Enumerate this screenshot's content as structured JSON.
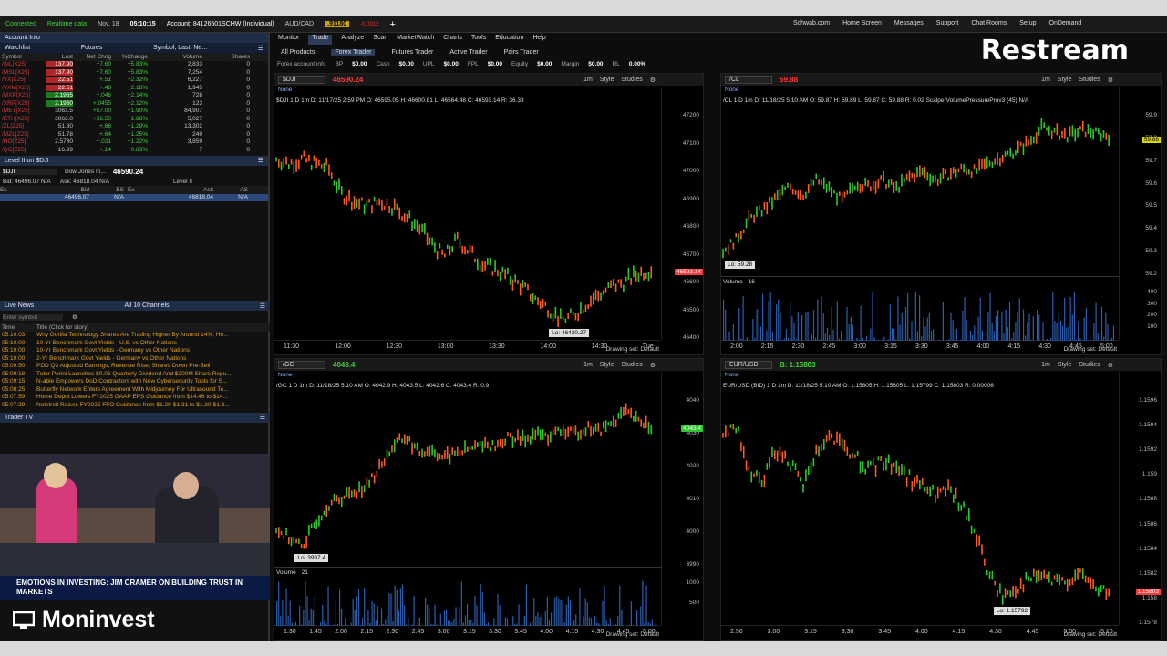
{
  "topbar": {
    "connected": "Connected",
    "realtime": "Realtime data",
    "date": "Nov, 18",
    "time": "05:10:15",
    "account": "Account: 84126501SCHW (Individual)",
    "pair": "AUD/CAD",
    "pair_price": ".91180",
    "pair_chg": "-0.0012"
  },
  "account_info": "Account Info",
  "watchlist": {
    "title": "Watchlist",
    "list": "Futures",
    "filter": "Symbol, Last, Ne...",
    "headers": [
      "Symbol",
      "Last",
      "Net Chng",
      "%Change",
      "Volume",
      "Shares"
    ],
    "rows": [
      [
        "/SIL[X25]",
        "137.90",
        "+7.60",
        "+5.83%",
        "2,833",
        "0"
      ],
      [
        "/MSL[X25]",
        "137.90",
        "+7.60",
        "+5.83%",
        "7,254",
        "0"
      ],
      [
        "/VX[X25]",
        "22.51",
        "+.51",
        "+2.32%",
        "6,227",
        "0"
      ],
      [
        "/VXM[X25]",
        "22.51",
        "+.48",
        "+2.18%",
        "1,945",
        "0"
      ],
      [
        "/MXP[X25]",
        "2.1965",
        "+.046",
        "+2.14%",
        "728",
        "0"
      ],
      [
        "/XRP[X25]",
        "2.1960",
        "+.0455",
        "+2.12%",
        "123",
        "0"
      ],
      [
        "/MET[X25]",
        "3063.5",
        "+57.00",
        "+1.90%",
        "84,907",
        "0"
      ],
      [
        "/ETH[X25]",
        "3063.0",
        "+56.50",
        "+1.88%",
        "5,027",
        "0"
      ],
      [
        "/ZL[Z25]",
        "51.80",
        "+.66",
        "+1.29%",
        "13,302",
        "0"
      ],
      [
        "/MZL[Z25]",
        "51.78",
        "+.64",
        "+1.25%",
        "249",
        "0"
      ],
      [
        "/HO[Z25]",
        "2.5780",
        "+.031",
        "+1.22%",
        "3,859",
        "0"
      ],
      [
        "/QC[Z25]",
        "16.99",
        "+.14",
        "+0.83%",
        "7",
        "0"
      ]
    ]
  },
  "level2": {
    "title": "Level II on $DJI",
    "symbol": "$DJI",
    "name": "Dow Jones In...",
    "price": "46590.24",
    "bid": "Bid: 46496.07 N/A",
    "ask": "Ask: 46818.04 N/A",
    "label": "Level II",
    "headers": [
      "Ex",
      "Bid",
      "BS",
      "Ex",
      "Ask",
      "AS"
    ],
    "row": [
      "",
      "46496.07",
      "N/A",
      "",
      "46818.04",
      "N/A"
    ]
  },
  "live_news": {
    "title": "Live News",
    "channels": "All 10 Channels",
    "placeholder": "Enter symbol",
    "headers": [
      "Time",
      "Title (Click for story)"
    ],
    "rows": [
      [
        "05:10:03",
        "Why Gorilla Technology Shares Are Trading Higher By Around 14%; He..."
      ],
      [
        "05:10:00",
        "10-Yr Benchmark Govt Yields - U.S. vs Other Nations"
      ],
      [
        "05:10:00",
        "10-Yr Benchmark Govt Yields - Germany vs Other Nations"
      ],
      [
        "05:10:00",
        "2-Yr Benchmark Govt Yields - Germany vs Other Nations"
      ],
      [
        "05:09:50",
        "PDD Q3 Adjusted Earnings, Revenue Rise; Shares Down Pre-Bell"
      ],
      [
        "05:09:18",
        "Tutor Perini Launches $0.06 Quarterly Dividend And $200M Share Repu..."
      ],
      [
        "05:09:15",
        "N-able Empowers DoD Contractors with New Cybersecurity Tools for S..."
      ],
      [
        "05:08:25",
        "Butterfly Network Enters Agreement With Midjourney For Ultrasound Te..."
      ],
      [
        "05:07:59",
        "Home Depot Lowers FY2025 GAAP EPS Guidance from $14.46 to $14..."
      ],
      [
        "05:07:29",
        "Netstreit Raises FY2025 FFO Guidance from $1.29-$1.31 to $1.30-$1.3..."
      ]
    ]
  },
  "trader_tv": {
    "title": "Trader TV",
    "banner": "EMOTIONS IN INVESTING: JIM CRAMER ON BUILDING TRUST IN MARKETS"
  },
  "main_tabs": [
    "Monitor",
    "Trade",
    "Analyze",
    "Scan",
    "MarketWatch",
    "Charts",
    "Tools",
    "Education",
    "Help"
  ],
  "sub_tabs": [
    "All Products",
    "Forex Trader",
    "Futures Trader",
    "Active Trader",
    "Pairs Trader"
  ],
  "forex_info": {
    "label": "Forex account info",
    "bp": "BP",
    "bp_v": "$0.00",
    "cash": "Cash",
    "cash_v": "$0.00",
    "upl": "UPL",
    "upl_v": "$0.00",
    "fpl": "FPL",
    "fpl_v": "$0.00",
    "equity": "Equity",
    "equity_v": "$0.00",
    "margin": "Margin",
    "margin_v": "$0.00",
    "rl": "RL",
    "rl_v": "0.00%"
  },
  "links": [
    "Schwab.com",
    "Home Screen",
    "Messages",
    "Support",
    "Chat Rooms",
    "Setup",
    "OnDemand"
  ],
  "brand": {
    "restream": "Restream",
    "moninvest": "Moninvest"
  },
  "charts": [
    {
      "symbol": "$DJI",
      "price": "46590.24",
      "info": "$DJI 1 D 1m  D: 11/17/25 2:59 PM  O: 46595.05  H: 46600.81  L: 46564.48  C: 46593.14  R: 36.33",
      "last": "46593.14",
      "lo": "Lo: 46430.27",
      "yticks": [
        "47200",
        "47100",
        "47000",
        "46900",
        "46800",
        "46700",
        "46600",
        "46500",
        "46400"
      ],
      "xticks": [
        "11:30",
        "12:00",
        "12:30",
        "13:00",
        "13:30",
        "14:00",
        "14:30",
        "Tue"
      ]
    },
    {
      "symbol": "/CL",
      "price": "59.88",
      "info": "/CL 1 D 1m  D: 11/18/25 5:10 AM  O: 59.87  H: 59.89  L: 59.87  C: 59.88  R: 0.02  ScalperVolumePressureProv3 (45)  N/A",
      "last": "59.88",
      "lo": "Lo: 59.28",
      "volume_label": "Volume",
      "volume_val": "16",
      "yticks": [
        "59.9",
        "59.8",
        "59.7",
        "59.6",
        "59.5",
        "59.4",
        "59.3",
        "59.2"
      ],
      "vticks": [
        "400",
        "300",
        "200",
        "100"
      ],
      "xticks": [
        "2:00",
        "2:15",
        "2:30",
        "2:45",
        "3:00",
        "3:15",
        "3:30",
        "3:45",
        "4:00",
        "4:15",
        "4:30",
        "4:45",
        "5:00"
      ]
    },
    {
      "symbol": "/GC",
      "price": "4043.4",
      "info": "/GC 1 D 1m  D: 11/18/25 5:10 AM  O: 4042.9  H: 4043.5  L: 4042.6  C: 4043.4  R: 0.9",
      "last": "4043.4",
      "lo": "Lo: 3997.4",
      "volume_label": "Volume",
      "volume_val": "21",
      "yticks": [
        "4040",
        "4030",
        "4020",
        "4010",
        "4000",
        "3990"
      ],
      "vticks": [
        "1000",
        "500"
      ],
      "xticks": [
        "1:30",
        "1:45",
        "2:00",
        "2:15",
        "2:30",
        "2:45",
        "3:00",
        "3:15",
        "3:30",
        "3:45",
        "4:00",
        "4:15",
        "4:30",
        "4:45",
        "5:00"
      ]
    },
    {
      "symbol": "EUR/USD",
      "price": "B: 1.15803",
      "info": "EUR/USD (BID) 1 D 1m  D: 11/18/25 5:10 AM  O: 1.15805  H: 1.15805  L: 1.15799  C: 1.15803  R: 0.00006",
      "last": "1.15803",
      "lo": "Lo: 1.15792",
      "yticks": [
        "1.1596",
        "1.1594",
        "1.1592",
        "1.159",
        "1.1588",
        "1.1586",
        "1.1584",
        "1.1582",
        "1.158",
        "1.1578"
      ],
      "xticks": [
        "2:50",
        "3:00",
        "3:15",
        "3:30",
        "3:45",
        "4:00",
        "4:15",
        "4:30",
        "4:45",
        "5:00",
        "5:10"
      ]
    }
  ],
  "draw_set": "Drawing set: Default",
  "toolbar": {
    "style": "Style",
    "studies": "Studies",
    "interval": "1m",
    "none": "None"
  }
}
